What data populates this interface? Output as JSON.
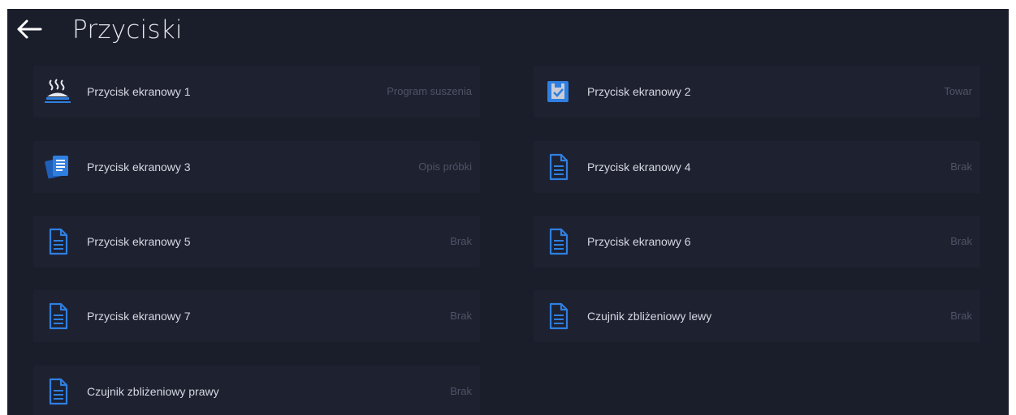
{
  "header": {
    "back_icon": "arrow-left-icon",
    "title": "Przyciski"
  },
  "buttons": [
    {
      "label": "Przycisk ekranowy 1",
      "value": "Program suszenia",
      "icon": "drying-program-icon"
    },
    {
      "label": "Przycisk ekranowy 2",
      "value": "Towar",
      "icon": "product-icon"
    },
    {
      "label": "Przycisk ekranowy 3",
      "value": "Opis próbki",
      "icon": "sample-description-icon"
    },
    {
      "label": "Przycisk ekranowy 4",
      "value": "Brak",
      "icon": "document-icon"
    },
    {
      "label": "Przycisk ekranowy 5",
      "value": "Brak",
      "icon": "document-icon"
    },
    {
      "label": "Przycisk ekranowy 6",
      "value": "Brak",
      "icon": "document-icon"
    },
    {
      "label": "Przycisk ekranowy 7",
      "value": "Brak",
      "icon": "document-icon"
    },
    {
      "label": "Czujnik zbliżeniowy lewy",
      "value": "Brak",
      "icon": "document-icon"
    },
    {
      "label": "Czujnik zbliżeniowy prawy",
      "value": "Brak",
      "icon": "document-icon"
    }
  ],
  "colors": {
    "background": "#1a1d2a",
    "tile": "#1e2130",
    "icon_accent": "#2f7fe0",
    "label_text": "#d6d9e2",
    "value_text": "#4f5466"
  }
}
